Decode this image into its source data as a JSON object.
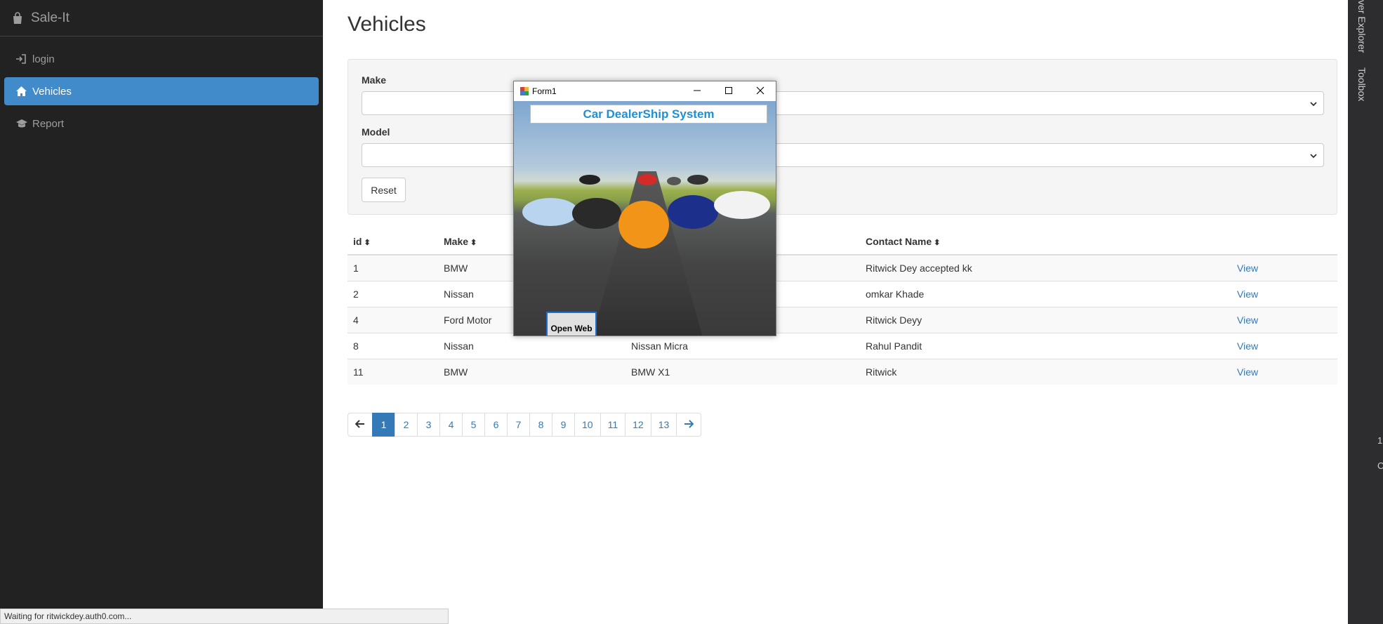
{
  "sidebar": {
    "brand": "Sale-It",
    "items": [
      {
        "label": "login",
        "icon": "sign-in-icon"
      },
      {
        "label": "Vehicles",
        "icon": "home-icon",
        "active": true
      },
      {
        "label": "Report",
        "icon": "graduation-cap-icon"
      }
    ]
  },
  "main": {
    "title": "Vehicles",
    "filters": {
      "make_label": "Make",
      "model_label": "Model",
      "reset_label": "Reset"
    },
    "table": {
      "columns": [
        "id",
        "Make",
        "",
        "Contact Name",
        ""
      ],
      "rows": [
        {
          "id": "1",
          "make": "BMW",
          "model": "",
          "contact": "Ritwick Dey accepted kk",
          "action": "View"
        },
        {
          "id": "2",
          "make": "Nissan",
          "model": "",
          "contact": "omkar Khade",
          "action": "View"
        },
        {
          "id": "4",
          "make": "Ford Motor",
          "model": "",
          "contact": "Ritwick Deyy",
          "action": "View"
        },
        {
          "id": "8",
          "make": "Nissan",
          "model": "Nissan Micra",
          "contact": "Rahul Pandit",
          "action": "View"
        },
        {
          "id": "11",
          "make": "BMW",
          "model": "BMW X1",
          "contact": "Ritwick",
          "action": "View"
        }
      ]
    },
    "pagination": {
      "pages": [
        "1",
        "2",
        "3",
        "4",
        "5",
        "6",
        "7",
        "8",
        "9",
        "10",
        "11",
        "12",
        "13"
      ],
      "current": "1"
    }
  },
  "statusbar": {
    "text": "Waiting for ritwickdey.auth0.com..."
  },
  "ide": {
    "tabs": [
      "ver Explorer",
      "Toolbox"
    ],
    "glyphs": [
      "1",
      "C"
    ]
  },
  "form1": {
    "window_title": "Form1",
    "app_title": "Car DealerShip System",
    "open_web_label": "Open Web"
  },
  "colors": {
    "sidebar_bg": "#222222",
    "accent": "#428bca",
    "link": "#337ab7",
    "app_title": "#1e90d6"
  }
}
